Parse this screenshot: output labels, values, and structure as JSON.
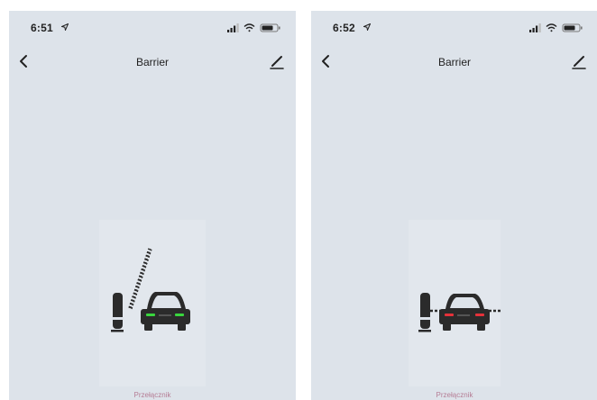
{
  "screens": [
    {
      "status_time": "6:51",
      "title": "Barrier",
      "device_label": "Przełącznik",
      "barrier_state": "open",
      "light_color": "#39d63e",
      "icons": {
        "location": "location-arrow-icon",
        "signal": "cellular-signal-icon",
        "wifi": "wifi-icon",
        "battery": "battery-icon",
        "back": "chevron-left-icon",
        "edit": "pencil-icon",
        "device": "barrier-car-icon"
      }
    },
    {
      "status_time": "6:52",
      "title": "Barrier",
      "device_label": "Przełącznik",
      "barrier_state": "closed",
      "light_color": "#e5323a",
      "icons": {
        "location": "location-arrow-icon",
        "signal": "cellular-signal-icon",
        "wifi": "wifi-icon",
        "battery": "battery-icon",
        "back": "chevron-left-icon",
        "edit": "pencil-icon",
        "device": "barrier-car-icon"
      }
    }
  ]
}
